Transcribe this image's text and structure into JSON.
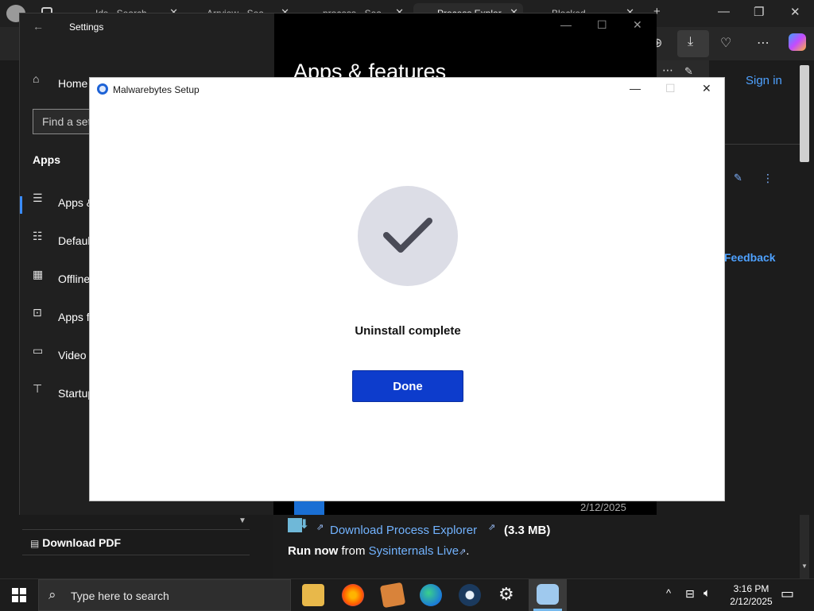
{
  "browser": {
    "tabs": [
      {
        "label": "Ids - Search"
      },
      {
        "label": "Arrview - Sea"
      },
      {
        "label": "process - Sea"
      },
      {
        "label": "Process Explor"
      },
      {
        "label": "Blocked"
      }
    ],
    "sign_in": "Sign in",
    "feedback": "Feedback"
  },
  "settings": {
    "title": "Settings",
    "home": "Home",
    "search_placeholder": "Find a setting",
    "section": "Apps",
    "page_heading": "Apps & features",
    "nav": [
      {
        "label": "Apps & features",
        "icon": "apps-features-icon"
      },
      {
        "label": "Default apps",
        "icon": "default-apps-icon"
      },
      {
        "label": "Offline maps",
        "icon": "offline-maps-icon"
      },
      {
        "label": "Apps for websites",
        "icon": "apps-websites-icon"
      },
      {
        "label": "Video playback",
        "icon": "video-playback-icon"
      },
      {
        "label": "Startup",
        "icon": "startup-icon"
      }
    ]
  },
  "page": {
    "date": "2/12/2025",
    "download_pdf": "Download PDF",
    "download_link": "Download Process Explorer",
    "download_size": "(3.3 MB)",
    "run_now_prefix": "Run now",
    "run_now_from": "from",
    "run_now_link": "Sysinternals Live",
    "run_now_suffix": "."
  },
  "dialog": {
    "title": "Malwarebytes Setup",
    "status": "Uninstall complete",
    "done_label": "Done",
    "check_color": "#4a4b57",
    "button_color": "#0d3ccc"
  },
  "taskbar": {
    "search_placeholder": "Type here to search",
    "time": "3:16 PM",
    "date": "2/12/2025"
  }
}
